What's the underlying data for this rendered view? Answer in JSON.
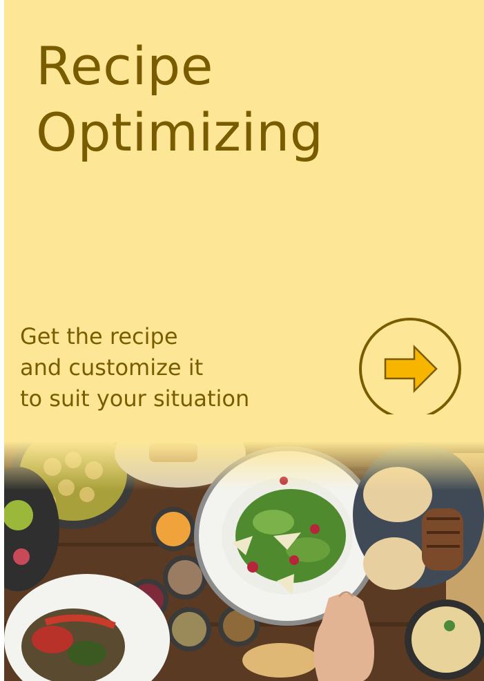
{
  "hero": {
    "title_line1": "Recipe",
    "title_line2": "Optimizing",
    "tagline_lines": [
      "Get the recipe",
      "and customize it",
      "to suit your situation"
    ],
    "cta_icon": "right-arrow-icon"
  },
  "photo": {
    "subject": "food-table-photo"
  },
  "colors": {
    "background": "#fde796",
    "text": "#7a5c00",
    "arrow_fill": "#f7b500"
  }
}
